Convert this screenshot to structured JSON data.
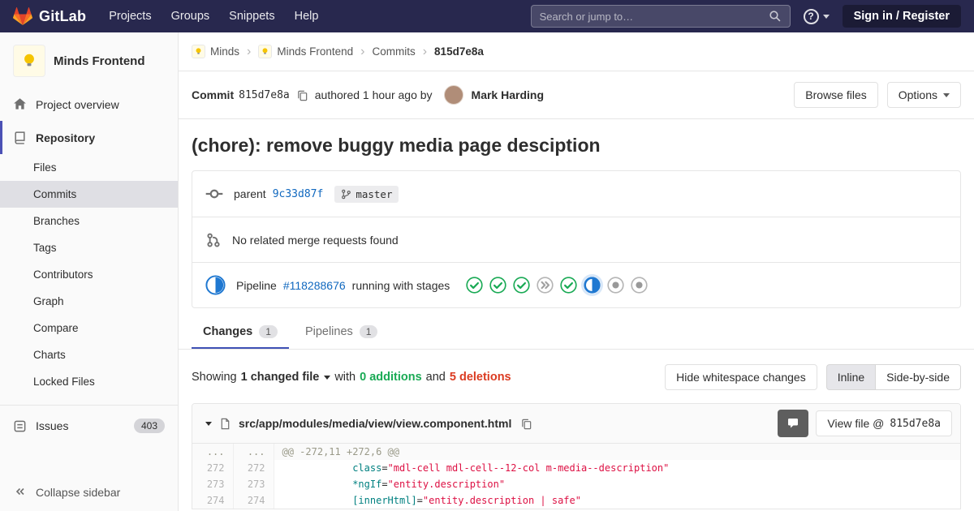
{
  "colors": {
    "navbar_bg": "#28284e",
    "link_blue": "#1068bf",
    "success_green": "#1aaa55",
    "danger_red": "#db3b21",
    "brand_orange": "#fc6d26",
    "running_blue": "#1f78d1",
    "tab_active_underline": "#3f51b5"
  },
  "navbar": {
    "logo_text": "GitLab",
    "links": [
      "Projects",
      "Groups",
      "Snippets",
      "Help"
    ],
    "search_placeholder": "Search or jump to…",
    "help_label": "?",
    "sign_in_label": "Sign in / Register"
  },
  "sidebar": {
    "project_name": "Minds Frontend",
    "items": {
      "overview": "Project overview",
      "repository": "Repository",
      "issues": "Issues",
      "issues_count": "403",
      "collapse": "Collapse sidebar"
    },
    "repo_items": [
      "Files",
      "Commits",
      "Branches",
      "Tags",
      "Contributors",
      "Graph",
      "Compare",
      "Charts",
      "Locked Files"
    ]
  },
  "breadcrumb": {
    "separator": "›",
    "items": [
      "Minds",
      "Minds Frontend",
      "Commits"
    ],
    "current": "815d7e8a"
  },
  "commit": {
    "label": "Commit",
    "sha": "815d7e8a",
    "authored_text": "authored 1 hour ago by",
    "author": "Mark Harding",
    "browse_files_label": "Browse files",
    "options_label": "Options",
    "title": "(chore): remove buggy media page desciption",
    "parent_label": "parent",
    "parent_sha": "9c33d87f",
    "branch_name": "master",
    "merge_request_text": "No related merge requests found",
    "pipeline_label": "Pipeline",
    "pipeline_id": "#118288676",
    "pipeline_status_text": "running with stages",
    "pipeline_stages": [
      "passed",
      "passed",
      "passed",
      "skipped",
      "passed",
      "running",
      "created",
      "created"
    ]
  },
  "tabs": {
    "changes_label": "Changes",
    "changes_count": "1",
    "pipelines_label": "Pipelines",
    "pipelines_count": "1"
  },
  "summary": {
    "showing": "Showing",
    "changed_files": "1 changed file",
    "with_text": "with",
    "additions": "0 additions",
    "and_text": "and",
    "deletions": "5 deletions",
    "hide_whitespace_label": "Hide whitespace changes",
    "inline_label": "Inline",
    "side_by_side_label": "Side-by-side"
  },
  "diff": {
    "file_path": "src/app/modules/media/view/view.component.html",
    "view_file_label": "View file @",
    "view_file_sha": "815d7e8a",
    "hunk": {
      "old": "...",
      "new": "...",
      "text": "@@ -272,11 +272,6 @@"
    },
    "lines": [
      {
        "old": "272",
        "new": "272",
        "seg0": "            class",
        "seg1": "=",
        "seg2": "\"mdl-cell mdl-cell--12-col m-media--description\""
      },
      {
        "old": "273",
        "new": "273",
        "seg0": "            *ngIf",
        "seg1": "=",
        "seg2": "\"entity.description\""
      },
      {
        "old": "274",
        "new": "274",
        "seg0": "            [innerHtml]",
        "seg1": "=",
        "seg2": "\"entity.description | safe\""
      }
    ]
  }
}
